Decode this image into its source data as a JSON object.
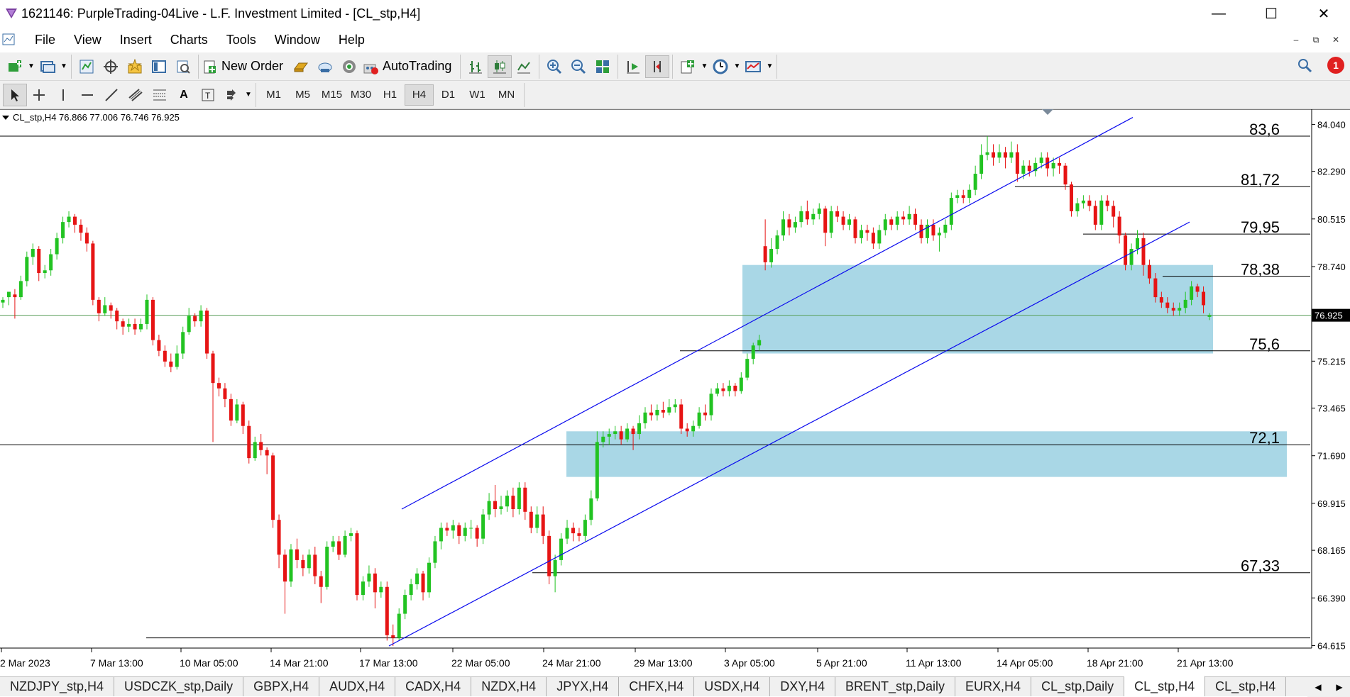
{
  "window": {
    "title": "1621146: PurpleTrading-04Live - L.F. Investment Limited - [CL_stp,H4]",
    "minimize": "—",
    "maximize": "☐",
    "close": "✕"
  },
  "menu": [
    "File",
    "View",
    "Insert",
    "Charts",
    "Tools",
    "Window",
    "Help"
  ],
  "toolbar": {
    "new_order": "New Order",
    "autotrading": "AutoTrading",
    "notification_count": "1"
  },
  "timeframes": [
    {
      "label": "M1",
      "active": false
    },
    {
      "label": "M5",
      "active": false
    },
    {
      "label": "M15",
      "active": false
    },
    {
      "label": "M30",
      "active": false
    },
    {
      "label": "H1",
      "active": false
    },
    {
      "label": "H4",
      "active": true
    },
    {
      "label": "D1",
      "active": false
    },
    {
      "label": "W1",
      "active": false
    },
    {
      "label": "MN",
      "active": false
    }
  ],
  "chart_data": {
    "type": "candlestick",
    "info": "CL_stp,H4  76.866 77.006 76.746 76.925",
    "symbol": "CL_stp,H4",
    "current_price": 76.925,
    "current_price_label": "76.925",
    "price_axis": [
      "84.040",
      "82.290",
      "80.515",
      "78.740",
      "76.925",
      "75.215",
      "73.465",
      "71.690",
      "69.915",
      "68.165",
      "66.390",
      "64.615"
    ],
    "ylim": [
      64.0,
      84.2
    ],
    "time_axis": [
      "2 Mar 2023",
      "7 Mar 13:00",
      "10 Mar 05:00",
      "14 Mar 21:00",
      "17 Mar 13:00",
      "22 Mar 05:00",
      "24 Mar 21:00",
      "29 Mar 13:00",
      "3 Apr 05:00",
      "5 Apr 21:00",
      "11 Apr 13:00",
      "14 Apr 05:00",
      "18 Apr 21:00",
      "21 Apr 13:00"
    ],
    "levels": [
      {
        "label": "83,6",
        "value": 83.6
      },
      {
        "label": "81,72",
        "value": 81.72
      },
      {
        "label": "79,95",
        "value": 79.95
      },
      {
        "label": "78,38",
        "value": 78.38
      },
      {
        "label": "75,6",
        "value": 75.6
      },
      {
        "label": "72,1",
        "value": 72.1
      },
      {
        "label": "67,33",
        "value": 67.33
      }
    ],
    "zones": [
      {
        "from": 75.5,
        "to": 78.8
      },
      {
        "from": 70.9,
        "to": 72.6
      }
    ],
    "colors": {
      "bull": "#22c322",
      "bear": "#e61414",
      "trend": "#0a0aee",
      "zone": "#a9d7e6",
      "level": "#000000",
      "current": "#5a9e5a"
    },
    "candles": [
      [
        77.4,
        77.5,
        77.2,
        77.6
      ],
      [
        77.6,
        77.8,
        77.3,
        77.7
      ],
      [
        77.7,
        77.6,
        76.8,
        77.9
      ],
      [
        77.6,
        78.2,
        77.5,
        78.4
      ],
      [
        78.2,
        79.1,
        78.0,
        79.3
      ],
      [
        79.1,
        79.4,
        78.8,
        79.6
      ],
      [
        79.4,
        78.5,
        78.2,
        79.5
      ],
      [
        78.5,
        78.6,
        78.3,
        78.8
      ],
      [
        78.6,
        79.2,
        78.4,
        79.4
      ],
      [
        79.2,
        79.8,
        79.0,
        80.0
      ],
      [
        79.8,
        80.4,
        79.6,
        80.6
      ],
      [
        80.4,
        80.6,
        80.2,
        80.8
      ],
      [
        80.6,
        80.3,
        80.0,
        80.7
      ],
      [
        80.3,
        80.0,
        79.7,
        80.5
      ],
      [
        80.0,
        79.6,
        79.3,
        80.2
      ],
      [
        79.6,
        77.5,
        77.3,
        79.7
      ],
      [
        77.5,
        77.0,
        76.7,
        77.6
      ],
      [
        77.0,
        77.3,
        76.9,
        77.6
      ],
      [
        77.3,
        77.1,
        76.8,
        77.4
      ],
      [
        77.1,
        76.7,
        76.4,
        77.2
      ],
      [
        76.7,
        76.5,
        76.2,
        76.8
      ],
      [
        76.5,
        76.6,
        76.3,
        76.8
      ],
      [
        76.6,
        76.4,
        76.2,
        76.8
      ],
      [
        76.4,
        76.6,
        76.3,
        76.8
      ],
      [
        76.6,
        77.5,
        76.4,
        77.7
      ],
      [
        77.5,
        76.0,
        75.8,
        77.6
      ],
      [
        76.0,
        75.6,
        75.4,
        76.2
      ],
      [
        75.6,
        75.2,
        75.0,
        75.8
      ],
      [
        75.2,
        75.0,
        74.8,
        75.5
      ],
      [
        75.0,
        75.5,
        74.9,
        75.8
      ],
      [
        75.5,
        76.3,
        75.3,
        76.5
      ],
      [
        76.3,
        76.9,
        76.2,
        77.2
      ],
      [
        76.9,
        76.7,
        76.5,
        77.0
      ],
      [
        76.7,
        77.1,
        76.5,
        77.3
      ],
      [
        77.1,
        75.5,
        75.3,
        77.2
      ],
      [
        75.5,
        74.4,
        72.2,
        75.6
      ],
      [
        74.4,
        74.2,
        73.9,
        74.6
      ],
      [
        74.2,
        73.8,
        73.5,
        74.4
      ],
      [
        73.8,
        73.0,
        72.8,
        74.0
      ],
      [
        73.0,
        73.6,
        72.9,
        73.8
      ],
      [
        73.6,
        72.8,
        72.5,
        73.7
      ],
      [
        72.8,
        71.6,
        71.4,
        73.0
      ],
      [
        71.6,
        72.2,
        71.5,
        72.4
      ],
      [
        72.2,
        71.9,
        71.7,
        72.5
      ],
      [
        71.9,
        71.7,
        71.0,
        72.0
      ],
      [
        71.7,
        69.3,
        69.0,
        71.8
      ],
      [
        69.3,
        68.0,
        67.5,
        69.5
      ],
      [
        68.0,
        67.0,
        65.8,
        68.2
      ],
      [
        67.0,
        68.2,
        66.8,
        68.4
      ],
      [
        68.2,
        67.8,
        67.5,
        68.6
      ],
      [
        67.8,
        67.5,
        67.2,
        68.0
      ],
      [
        67.5,
        68.0,
        67.3,
        68.2
      ],
      [
        68.0,
        67.2,
        66.9,
        68.3
      ],
      [
        67.2,
        66.8,
        66.2,
        67.4
      ],
      [
        66.8,
        68.3,
        66.7,
        68.5
      ],
      [
        68.3,
        68.5,
        68.1,
        68.7
      ],
      [
        68.5,
        68.0,
        67.8,
        68.7
      ],
      [
        68.0,
        68.7,
        67.9,
        68.9
      ],
      [
        68.7,
        68.8,
        68.5,
        69.0
      ],
      [
        68.8,
        66.5,
        66.3,
        68.9
      ],
      [
        66.5,
        67.0,
        66.3,
        67.2
      ],
      [
        67.0,
        67.3,
        66.8,
        67.6
      ],
      [
        67.3,
        66.6,
        66.0,
        67.5
      ],
      [
        66.6,
        66.8,
        66.4,
        67.0
      ],
      [
        66.8,
        65.0,
        64.8,
        67.0
      ],
      [
        65.0,
        64.9,
        64.6,
        65.4
      ],
      [
        64.9,
        65.8,
        64.8,
        66.0
      ],
      [
        65.8,
        66.5,
        65.6,
        66.7
      ],
      [
        66.5,
        66.9,
        66.3,
        67.1
      ],
      [
        66.9,
        67.3,
        66.7,
        67.5
      ],
      [
        67.3,
        66.6,
        66.3,
        67.4
      ],
      [
        66.6,
        67.7,
        66.4,
        67.9
      ],
      [
        67.7,
        68.5,
        67.5,
        68.7
      ],
      [
        68.5,
        69.0,
        68.2,
        69.2
      ],
      [
        69.0,
        68.9,
        68.7,
        69.2
      ],
      [
        68.9,
        69.1,
        68.6,
        69.3
      ],
      [
        69.1,
        68.7,
        68.4,
        69.2
      ],
      [
        68.7,
        69.0,
        68.5,
        69.2
      ],
      [
        69.0,
        69.0,
        68.6,
        69.3
      ],
      [
        69.0,
        68.6,
        68.3,
        69.1
      ],
      [
        68.6,
        69.5,
        68.4,
        69.7
      ],
      [
        69.5,
        70.0,
        69.3,
        70.3
      ],
      [
        70.0,
        69.7,
        69.4,
        70.6
      ],
      [
        69.7,
        69.8,
        69.5,
        70.2
      ],
      [
        69.8,
        70.2,
        69.6,
        70.4
      ],
      [
        70.2,
        69.7,
        69.4,
        70.5
      ],
      [
        69.7,
        70.5,
        69.5,
        70.7
      ],
      [
        70.5,
        69.6,
        69.3,
        70.7
      ],
      [
        69.6,
        69.0,
        68.8,
        69.8
      ],
      [
        69.0,
        69.5,
        68.8,
        69.8
      ],
      [
        69.5,
        68.7,
        68.4,
        69.8
      ],
      [
        68.7,
        67.2,
        66.9,
        68.9
      ],
      [
        67.2,
        67.8,
        66.6,
        68.0
      ],
      [
        67.8,
        68.6,
        67.6,
        68.8
      ],
      [
        68.6,
        69.0,
        68.4,
        69.3
      ],
      [
        69.0,
        68.8,
        68.5,
        69.2
      ],
      [
        68.8,
        68.7,
        68.5,
        69.0
      ],
      [
        68.7,
        69.3,
        68.5,
        69.5
      ],
      [
        69.3,
        70.1,
        69.1,
        70.4
      ],
      [
        70.1,
        72.2,
        70.0,
        72.6
      ],
      [
        72.2,
        72.4,
        72.0,
        72.6
      ],
      [
        72.4,
        72.5,
        72.1,
        72.7
      ],
      [
        72.5,
        72.6,
        72.3,
        72.8
      ],
      [
        72.6,
        72.3,
        72.1,
        72.8
      ],
      [
        72.3,
        72.7,
        72.2,
        72.9
      ],
      [
        72.7,
        72.5,
        71.9,
        72.8
      ],
      [
        72.5,
        72.9,
        72.3,
        73.2
      ],
      [
        72.9,
        73.3,
        72.7,
        73.5
      ],
      [
        73.3,
        73.2,
        73.0,
        73.6
      ],
      [
        73.2,
        73.4,
        73.0,
        73.6
      ],
      [
        73.4,
        73.3,
        73.1,
        73.7
      ],
      [
        73.3,
        73.5,
        73.2,
        73.8
      ],
      [
        73.5,
        73.6,
        73.3,
        73.8
      ],
      [
        73.6,
        72.7,
        72.5,
        73.8
      ],
      [
        72.7,
        72.6,
        72.4,
        72.9
      ],
      [
        72.6,
        72.8,
        72.4,
        73.0
      ],
      [
        72.8,
        73.3,
        72.7,
        73.5
      ],
      [
        73.3,
        73.2,
        73.0,
        73.6
      ],
      [
        73.2,
        74.0,
        73.0,
        74.2
      ],
      [
        74.0,
        74.2,
        73.9,
        74.4
      ],
      [
        74.2,
        74.1,
        73.9,
        74.4
      ],
      [
        74.1,
        74.3,
        73.9,
        74.5
      ],
      [
        74.3,
        74.1,
        73.9,
        74.4
      ],
      [
        74.1,
        74.6,
        74.0,
        74.8
      ],
      [
        74.6,
        75.3,
        74.5,
        75.5
      ],
      [
        75.3,
        75.8,
        75.1,
        75.9
      ],
      [
        75.8,
        76.0,
        75.6,
        76.2
      ],
      [
        79.5,
        78.9,
        78.6,
        80.5
      ],
      [
        78.9,
        79.4,
        78.7,
        79.8
      ],
      [
        79.4,
        79.9,
        79.2,
        80.1
      ],
      [
        79.9,
        80.5,
        79.7,
        80.8
      ],
      [
        80.5,
        80.2,
        79.9,
        80.7
      ],
      [
        80.2,
        80.4,
        80.0,
        80.6
      ],
      [
        80.4,
        80.8,
        80.2,
        81.0
      ],
      [
        80.8,
        80.5,
        80.3,
        81.2
      ],
      [
        80.5,
        80.7,
        80.3,
        80.9
      ],
      [
        80.7,
        80.9,
        80.5,
        81.1
      ],
      [
        80.9,
        80.0,
        79.5,
        81.0
      ],
      [
        80.0,
        80.8,
        79.8,
        81.0
      ],
      [
        80.8,
        80.6,
        80.4,
        81.0
      ],
      [
        80.6,
        80.3,
        80.1,
        80.8
      ],
      [
        80.3,
        80.5,
        80.1,
        80.7
      ],
      [
        80.5,
        79.8,
        79.6,
        80.6
      ],
      [
        79.8,
        80.1,
        79.6,
        80.3
      ],
      [
        80.1,
        80.0,
        79.7,
        80.3
      ],
      [
        80.0,
        79.6,
        79.4,
        80.2
      ],
      [
        79.6,
        80.1,
        79.4,
        80.3
      ],
      [
        80.1,
        80.5,
        79.9,
        80.7
      ],
      [
        80.5,
        80.3,
        80.1,
        80.6
      ],
      [
        80.3,
        80.6,
        80.1,
        80.8
      ],
      [
        80.6,
        80.5,
        80.3,
        80.8
      ],
      [
        80.5,
        80.7,
        80.3,
        81.0
      ],
      [
        80.7,
        80.3,
        80.1,
        80.9
      ],
      [
        80.3,
        79.8,
        79.6,
        80.5
      ],
      [
        79.8,
        80.3,
        79.6,
        80.5
      ],
      [
        80.3,
        79.9,
        79.7,
        80.5
      ],
      [
        79.9,
        80.0,
        79.3,
        80.2
      ],
      [
        80.0,
        80.3,
        79.8,
        80.5
      ],
      [
        80.3,
        81.3,
        80.1,
        81.5
      ],
      [
        81.3,
        81.4,
        81.1,
        81.6
      ],
      [
        81.4,
        81.3,
        81.1,
        81.6
      ],
      [
        81.3,
        81.6,
        81.1,
        81.8
      ],
      [
        81.6,
        82.2,
        81.4,
        82.5
      ],
      [
        82.2,
        82.9,
        82.0,
        83.3
      ],
      [
        82.9,
        83.0,
        82.7,
        83.6
      ],
      [
        83.0,
        82.8,
        82.5,
        83.3
      ],
      [
        82.8,
        83.0,
        82.6,
        83.3
      ],
      [
        83.0,
        82.8,
        82.4,
        83.2
      ],
      [
        82.8,
        83.0,
        82.6,
        83.4
      ],
      [
        83.0,
        82.2,
        81.9,
        83.3
      ],
      [
        82.2,
        82.5,
        82.0,
        82.7
      ],
      [
        82.5,
        82.3,
        82.1,
        82.7
      ],
      [
        82.3,
        82.6,
        82.1,
        82.8
      ],
      [
        82.6,
        82.8,
        82.4,
        83.0
      ],
      [
        82.8,
        82.4,
        82.1,
        83.0
      ],
      [
        82.4,
        82.6,
        82.1,
        82.8
      ],
      [
        82.6,
        82.5,
        82.2,
        82.8
      ],
      [
        82.5,
        81.8,
        81.6,
        82.6
      ],
      [
        81.8,
        80.8,
        80.6,
        81.9
      ],
      [
        80.8,
        81.1,
        80.6,
        81.3
      ],
      [
        81.1,
        81.2,
        80.9,
        81.4
      ],
      [
        81.2,
        81.0,
        80.8,
        81.4
      ],
      [
        81.0,
        80.3,
        80.1,
        81.2
      ],
      [
        80.3,
        81.2,
        80.1,
        81.4
      ],
      [
        81.2,
        81.0,
        80.8,
        81.4
      ],
      [
        81.0,
        80.6,
        80.2,
        81.2
      ],
      [
        80.6,
        79.9,
        79.6,
        80.8
      ],
      [
        79.9,
        78.8,
        78.6,
        80.0
      ],
      [
        78.8,
        79.4,
        78.6,
        79.6
      ],
      [
        79.4,
        79.8,
        79.2,
        80.1
      ],
      [
        79.8,
        78.8,
        78.4,
        80.0
      ],
      [
        78.8,
        78.3,
        78.1,
        79.0
      ],
      [
        78.3,
        77.6,
        77.4,
        78.5
      ],
      [
        77.6,
        77.4,
        77.2,
        77.8
      ],
      [
        77.4,
        77.2,
        77.0,
        77.6
      ],
      [
        77.2,
        77.1,
        76.9,
        77.4
      ],
      [
        77.1,
        77.2,
        76.9,
        77.4
      ],
      [
        77.2,
        77.5,
        77.0,
        77.8
      ],
      [
        77.5,
        78.0,
        77.3,
        78.2
      ],
      [
        78.0,
        77.8,
        77.6,
        78.1
      ],
      [
        77.8,
        77.3,
        77.0,
        78.0
      ],
      [
        76.866,
        76.925,
        76.746,
        77.006
      ]
    ]
  },
  "tabs": [
    {
      "label": "NZDJPY_stp,H4",
      "active": false
    },
    {
      "label": "USDCZK_stp,Daily",
      "active": false
    },
    {
      "label": "GBPX,H4",
      "active": false
    },
    {
      "label": "AUDX,H4",
      "active": false
    },
    {
      "label": "CADX,H4",
      "active": false
    },
    {
      "label": "NZDX,H4",
      "active": false
    },
    {
      "label": "JPYX,H4",
      "active": false
    },
    {
      "label": "CHFX,H4",
      "active": false
    },
    {
      "label": "USDX,H4",
      "active": false
    },
    {
      "label": "DXY,H4",
      "active": false
    },
    {
      "label": "BRENT_stp,Daily",
      "active": false
    },
    {
      "label": "EURX,H4",
      "active": false
    },
    {
      "label": "CL_stp,Daily",
      "active": false
    },
    {
      "label": "CL_stp,H4",
      "active": true
    },
    {
      "label": "CL_stp,H4",
      "active": false
    }
  ]
}
